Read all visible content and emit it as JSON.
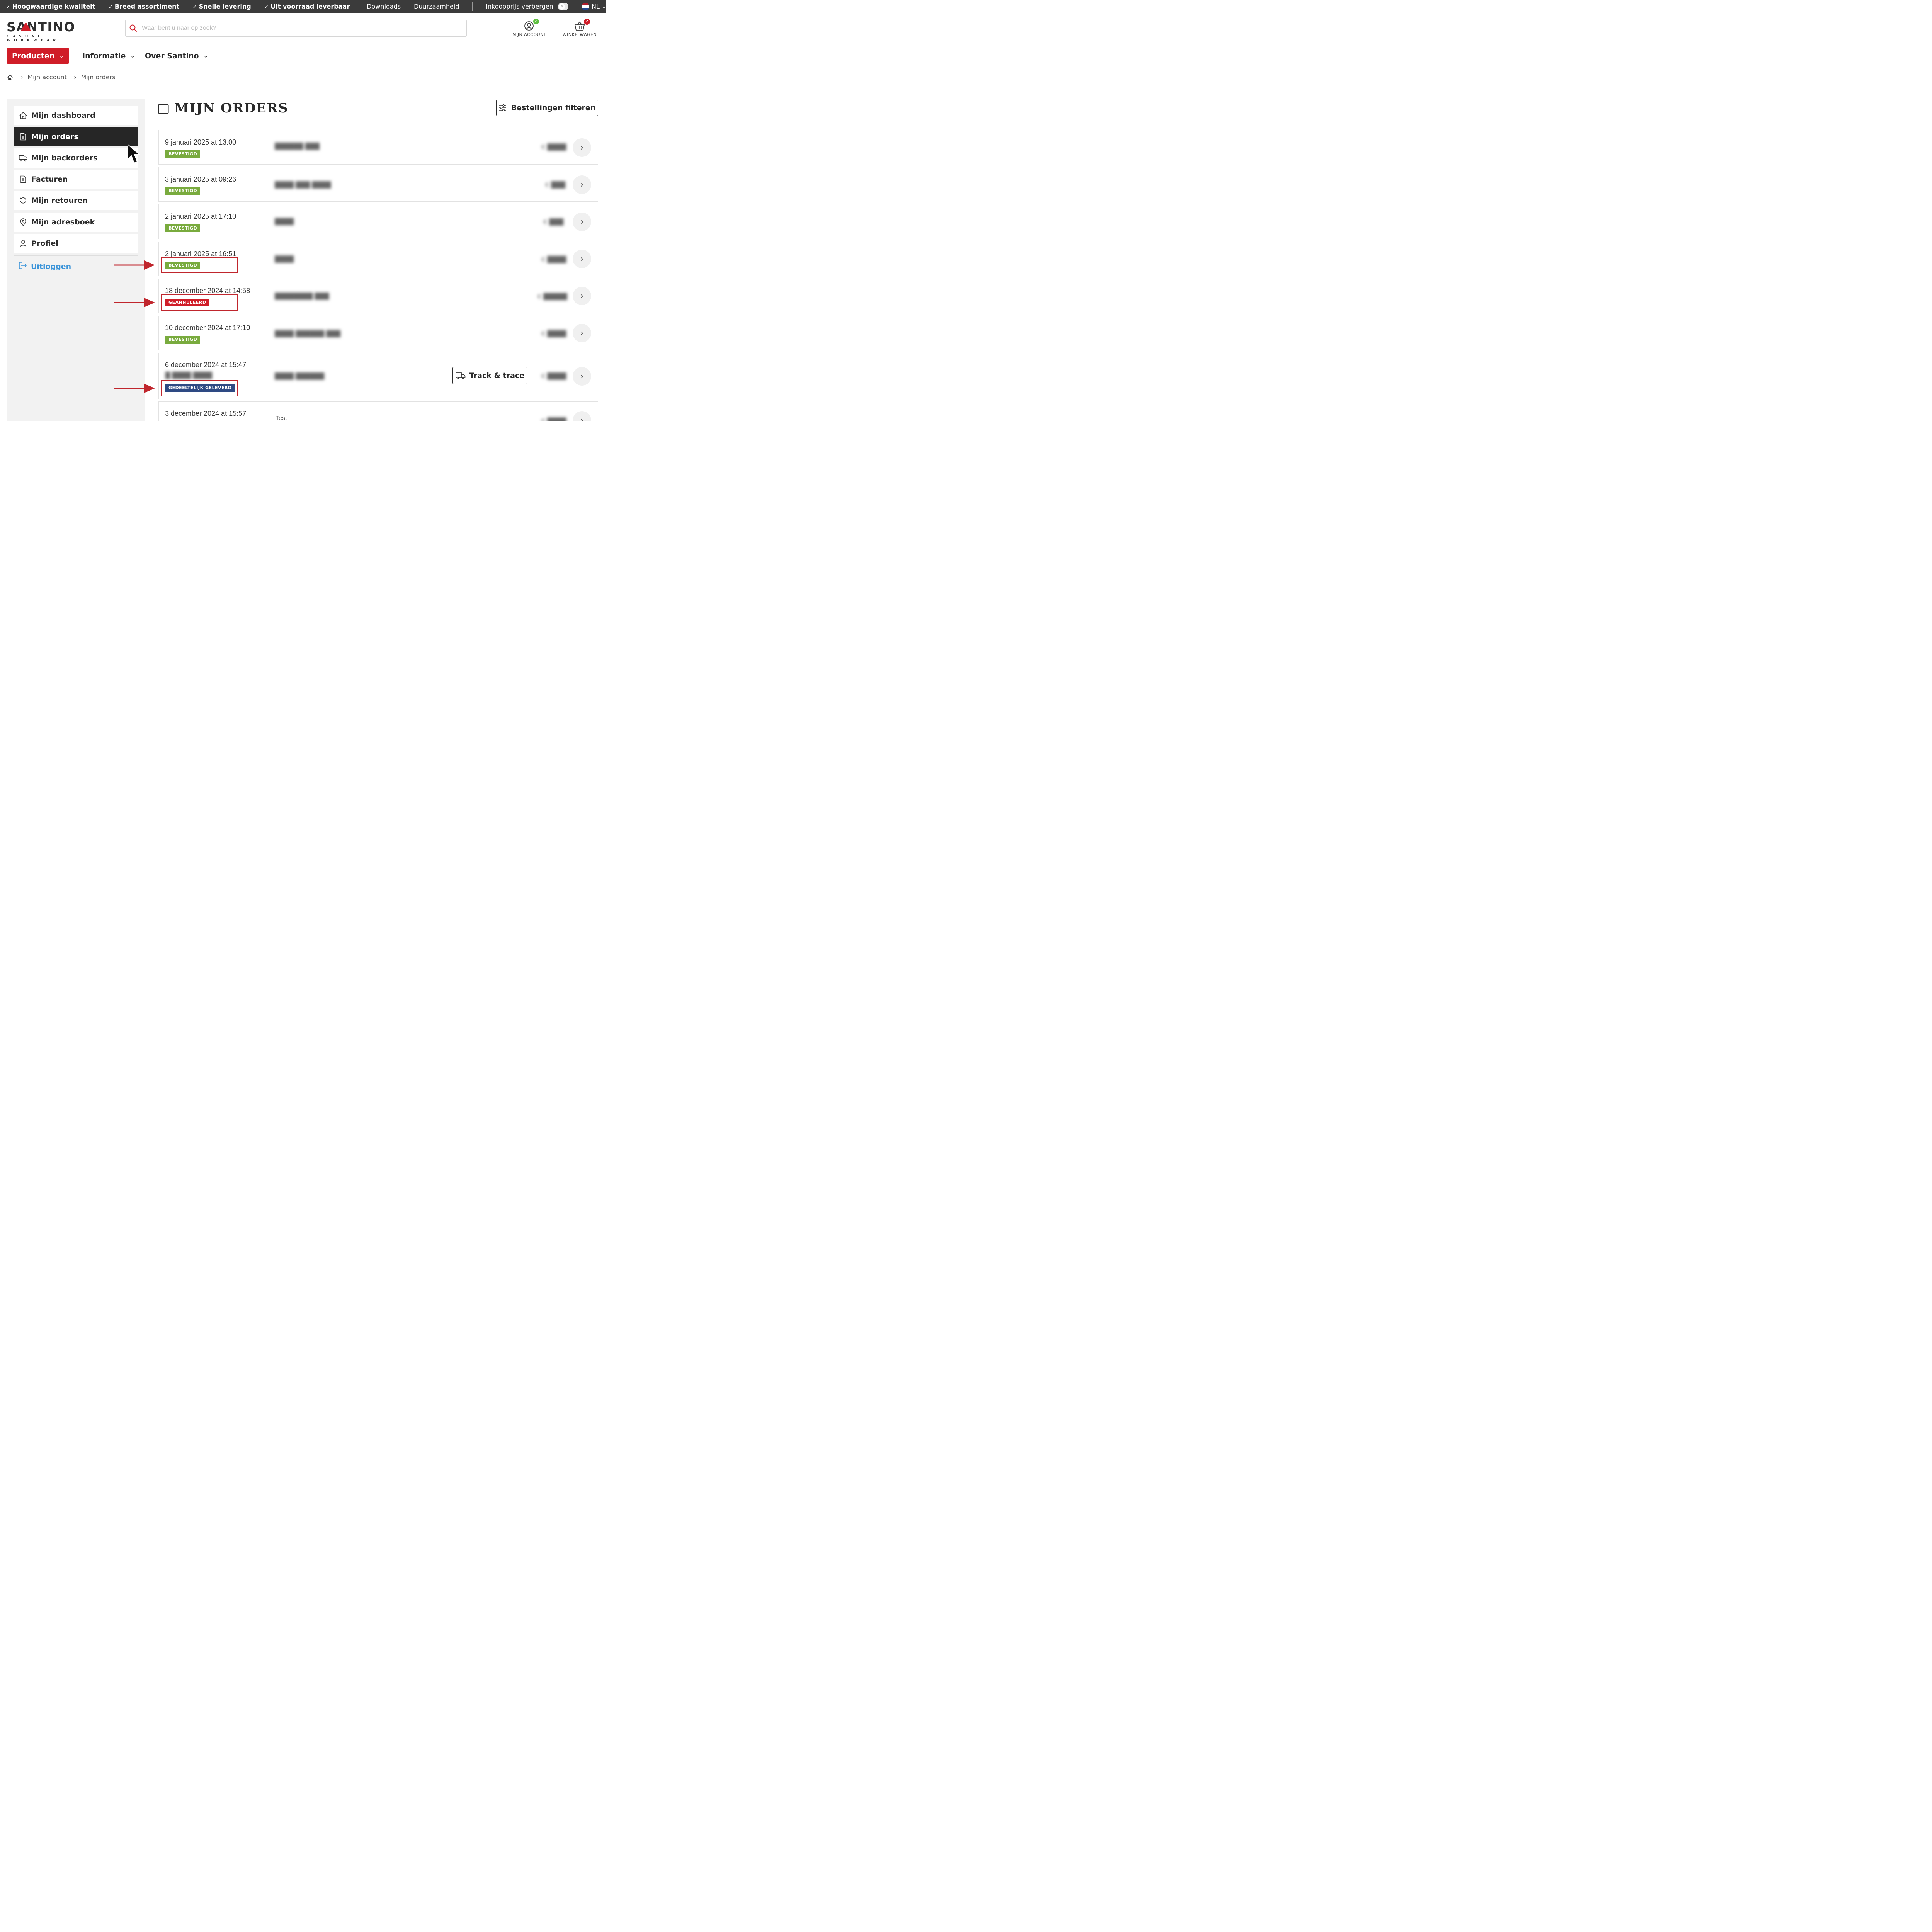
{
  "topbar": {
    "usps": [
      "Hoogwaardige kwaliteit",
      "Breed assortiment",
      "Snelle levering",
      "Uit voorraad leverbaar"
    ],
    "links": [
      "Downloads",
      "Duurzaamheid"
    ],
    "price_toggle_label": "Inkoopprijs verbergen",
    "language": "NL",
    "flag_colors": [
      "#ae1c28",
      "#ffffff",
      "#21468b"
    ]
  },
  "brand": {
    "logo_text": "SANTINO",
    "logo_subtitle": "CASUAL WORKWEAR",
    "accent_color": "#d01d28"
  },
  "search": {
    "placeholder": "Waar bent u naar op zoek?"
  },
  "header_actions": {
    "account_label": "MIJN ACCOUNT",
    "cart_label": "WINKELWAGEN",
    "cart_count": "2"
  },
  "nav": {
    "items": [
      "Producten",
      "Informatie",
      "Over Santino"
    ]
  },
  "breadcrumb": [
    "Mijn account",
    "Mijn orders"
  ],
  "sidebar": {
    "items": [
      {
        "label": "Mijn dashboard",
        "icon": "home-icon"
      },
      {
        "label": "Mijn orders",
        "icon": "document-icon",
        "active": true
      },
      {
        "label": "Mijn backorders",
        "icon": "truck-icon"
      },
      {
        "label": "Facturen",
        "icon": "invoice-icon"
      },
      {
        "label": "Mijn retouren",
        "icon": "return-icon"
      },
      {
        "label": "Mijn adresboek",
        "icon": "location-pin-icon"
      },
      {
        "label": "Profiel",
        "icon": "user-icon"
      }
    ],
    "logout_label": "Uitloggen"
  },
  "main": {
    "title": "MIJN ORDERS",
    "filter_button": "Bestellingen filteren",
    "track_trace_label": "Track & trace",
    "orders": [
      {
        "date": "9 januari 2025 at 13:00",
        "status": "BEVESTIGD",
        "status_type": "ok"
      },
      {
        "date": "3 januari 2025 at 09:26",
        "status": "BEVESTIGD",
        "status_type": "ok"
      },
      {
        "date": "2 januari 2025 at 17:10",
        "status": "BEVESTIGD",
        "status_type": "ok"
      },
      {
        "date": "2 januari 2025 at 16:51",
        "status": "BEVESTIGD",
        "status_type": "ok"
      },
      {
        "date": "18 december 2024 at 14:58",
        "status": "GEANNULEERD",
        "status_type": "cancel"
      },
      {
        "date": "10 december 2024 at 17:10",
        "status": "BEVESTIGD",
        "status_type": "ok"
      },
      {
        "date": "6 december 2024 at 15:47",
        "status": "GEDEELTELIJK GELEVERD",
        "status_type": "partial"
      },
      {
        "date": "3 december 2024 at 15:57",
        "reference": "Test"
      }
    ]
  },
  "colors": {
    "status_confirmed": "#79ab3e",
    "status_cancelled": "#d01d28",
    "status_partial": "#2e4a83",
    "annotation_red": "#c0262d",
    "topbar_bg": "#3b3b3b",
    "link_blue": "#3b94d9"
  }
}
